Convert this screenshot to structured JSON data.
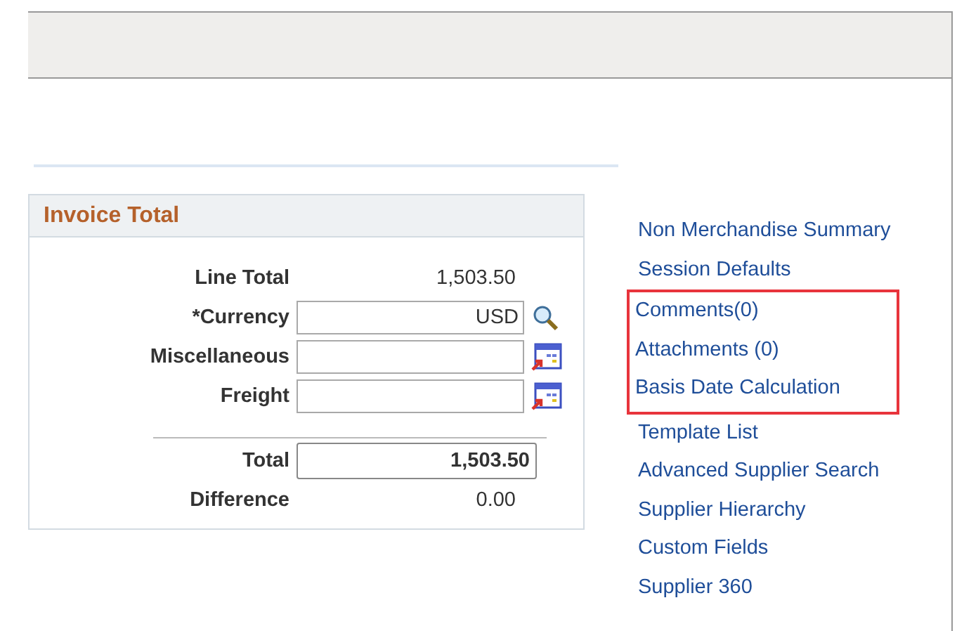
{
  "invoice_total": {
    "title": "Invoice Total",
    "rows": [
      {
        "label": "Line Total",
        "kind": "display",
        "value": "1,503.50"
      },
      {
        "label": "*Currency",
        "kind": "lookup",
        "value": "USD"
      },
      {
        "label": "Miscellaneous",
        "kind": "calculator"
      },
      {
        "label": "Freight",
        "kind": "calculator"
      }
    ],
    "totals": [
      {
        "label": "Total",
        "kind": "total",
        "value": "1,503.50"
      },
      {
        "label": "Difference",
        "kind": "display",
        "value": "0.00"
      }
    ]
  },
  "links": [
    {
      "label": "Non Merchandise Summary",
      "highlighted": false
    },
    {
      "label": "Session Defaults",
      "highlighted": false
    },
    {
      "label": "Comments(0)",
      "highlighted": true
    },
    {
      "label": "Attachments (0)",
      "highlighted": true
    },
    {
      "label": "Basis Date Calculation",
      "highlighted": true
    },
    {
      "label": "Template List",
      "highlighted": false
    },
    {
      "label": "Advanced Supplier Search",
      "highlighted": false
    },
    {
      "label": "Supplier Hierarchy",
      "highlighted": false
    },
    {
      "label": "Custom Fields",
      "highlighted": false
    },
    {
      "label": "Supplier 360",
      "highlighted": false
    }
  ]
}
